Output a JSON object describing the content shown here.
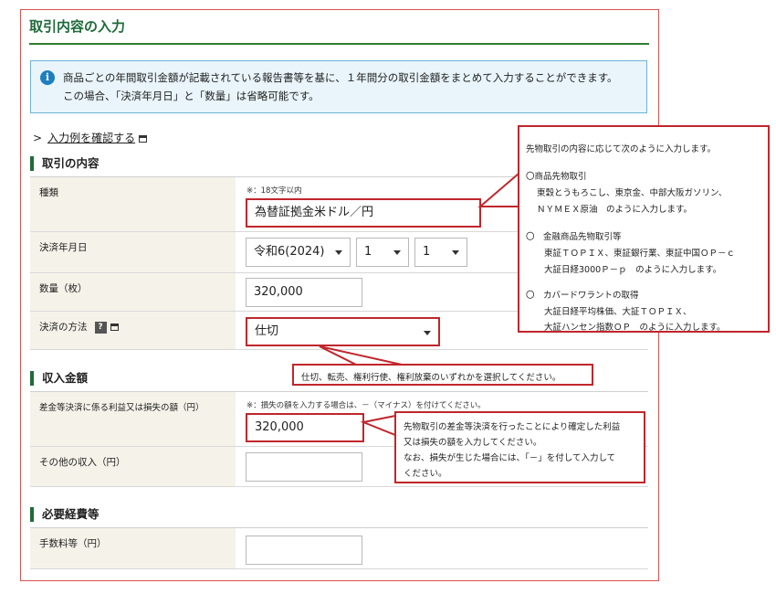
{
  "page": {
    "title": "取引内容の入力"
  },
  "info": {
    "line1": "商品ごとの年間取引金額が記載されている報告書等を基に、１年間分の取引金額をまとめて入力することができます。",
    "line2": "この場合、「決済年月日」と「数量」は省略可能です。"
  },
  "example_link": {
    "chevron": ">",
    "label": "入力例を確認する"
  },
  "sections": {
    "torihiki": "取引の内容",
    "shunyu": "収入金額",
    "keihi": "必要経費等"
  },
  "fields": {
    "kind": {
      "label": "種類",
      "note": "※：18文字以内",
      "value": "為替証拠金米ドル／円"
    },
    "date": {
      "label": "決済年月日",
      "era": "令和6(2024)",
      "month": "1",
      "day": "1"
    },
    "quantity": {
      "label": "数量（枚）",
      "value": "320,000"
    },
    "method": {
      "label": "決済の方法",
      "help": "?",
      "value": "仕切"
    },
    "profit": {
      "label": "差金等決済に係る利益又は損失の額（円）",
      "note": "※：損失の額を入力する場合は、－（マイナス）を付けてください。",
      "value": "320,000"
    },
    "other_income": {
      "label": "その他の収入（円）",
      "value": ""
    },
    "fee": {
      "label": "手数料等（円）",
      "value": ""
    }
  },
  "callouts": {
    "kind": {
      "intro": "先物取引の内容に応じて次のように入力します。",
      "h1": "〇商品先物取引",
      "l1a": "東穀とうもろこし、東京金、中部大阪ガソリン、",
      "l1b": "ＮＹＭＥＸ原油　のように入力します。",
      "h2": "〇　金融商品先物取引等",
      "l2a": "東証ＴＯＰＩＸ、東証銀行業、東証中国ＯＰ－ｃ",
      "l2b": "大証日経3000Ｐ－ｐ　のように入力します。",
      "h3": "〇　カバードワラントの取得",
      "l3a": "大証日経平均株価、大証ＴＯＰＩＸ、",
      "l3b": "大証ハンセン指数ＯＰ　のように入力します。"
    },
    "method": "仕切、転売、権利行使、権利放棄のいずれかを選択してください。",
    "profit": {
      "l1": "先物取引の差金等決済を行ったことにより確定した利益",
      "l2": "又は損失の額を入力してください。",
      "l3": "なお、損失が生じた場合には、「－」を付して入力して",
      "l4": "ください。"
    }
  },
  "colors": {
    "accent_green": "#1f6b3a",
    "callout_red": "#c0262c",
    "info_blue": "#1c7fbf"
  }
}
